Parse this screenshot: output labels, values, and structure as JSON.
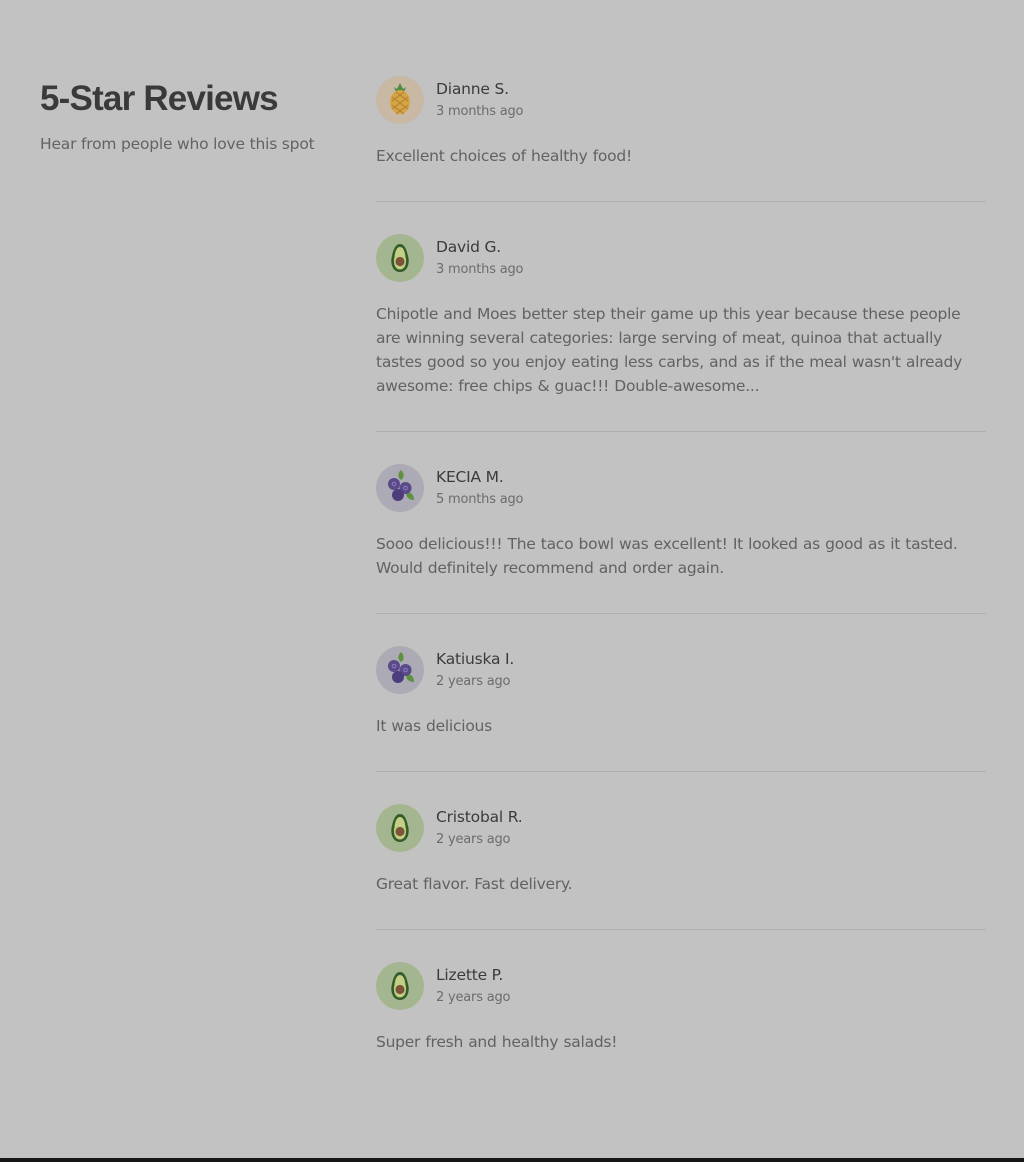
{
  "section": {
    "title": "5-Star Reviews",
    "subtitle": "Hear from people who love this spot"
  },
  "reviews": [
    {
      "name": "Dianne S.",
      "date": "3 months ago",
      "avatar_icon": "pineapple-icon",
      "text": "Excellent choices of healthy food!"
    },
    {
      "name": "David G.",
      "date": "3 months ago",
      "avatar_icon": "avocado-icon",
      "text": "Chipotle and Moes better step their game up this year because these people are winning several categories: large serving of meat, quinoa that actually tastes good so you enjoy eating less carbs, and as if the meal wasn't already awesome: free chips & guac!!! Double-awesome..."
    },
    {
      "name": "KECIA M.",
      "date": "5 months ago",
      "avatar_icon": "blueberry-icon",
      "text": "Sooo delicious!!! The taco bowl was excellent! It looked as good as it tasted. Would definitely recommend and order again."
    },
    {
      "name": "Katiuska I.",
      "date": "2 years ago",
      "avatar_icon": "blueberry-icon",
      "text": "It was delicious"
    },
    {
      "name": "Cristobal R.",
      "date": "2 years ago",
      "avatar_icon": "avocado-icon",
      "text": "Great flavor. Fast delivery."
    },
    {
      "name": "Lizette P.",
      "date": "2 years ago",
      "avatar_icon": "avocado-icon",
      "text": "Super fresh and healthy salads!"
    }
  ],
  "colors": {
    "background": "#c2c2c2",
    "heading": "#3a3a3a",
    "body_text": "#626262",
    "divider": "#aeaeae"
  }
}
